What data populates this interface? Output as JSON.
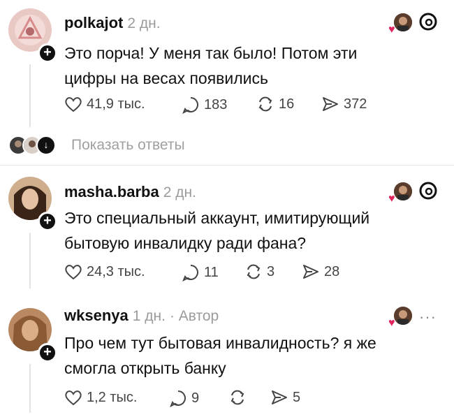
{
  "posts": [
    {
      "username": "polkajot",
      "time": "2 дн.",
      "author_tag": "",
      "text_lines": [
        "Это порча! У меня так было! Потом эти",
        "цифры на весах появились"
      ],
      "likes": "41,9 тыс.",
      "comments": "183",
      "reposts": "16",
      "shares": "372",
      "show_threads_icon": true
    },
    {
      "username": "masha.barba",
      "time": "2 дн.",
      "author_tag": "",
      "text_lines": [
        "Это специальный аккаунт, имитирующий",
        "бытовую инвалидку ради фана?"
      ],
      "likes": "24,3 тыс.",
      "comments": "11",
      "reposts": "3",
      "shares": "28",
      "show_threads_icon": true
    },
    {
      "username": "wksenya",
      "time": "1 дн.",
      "author_tag": "· Автор",
      "text_lines": [
        "Про чем тут бытовая инвалидность? я же",
        "смогла открыть банку"
      ],
      "likes": "1,2 тыс.",
      "comments": "9",
      "reposts": "",
      "shares": "5",
      "show_threads_icon": false
    }
  ],
  "show_replies_label": "Показать ответы",
  "icons": {
    "like": "heart-outline-icon",
    "comment": "comment-bubble-icon",
    "repost": "repost-arrows-icon",
    "share": "share-send-icon",
    "threads": "threads-logo-icon",
    "more": "more-dots-icon"
  },
  "colors": {
    "liked_heart": "#e0245e",
    "text": "#111111",
    "muted": "#9b9b9b"
  }
}
